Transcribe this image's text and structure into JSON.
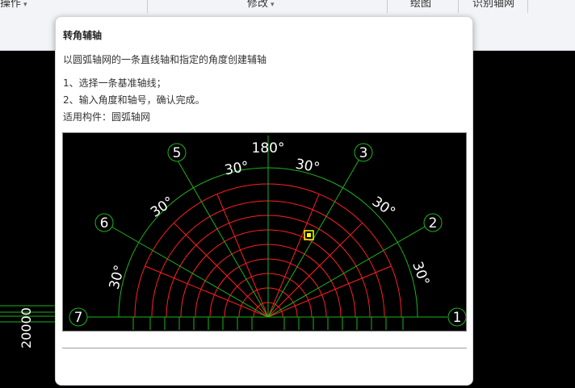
{
  "ribbon": {
    "groups": [
      {
        "label": "操作",
        "has_dropdown": true
      },
      {
        "label": "修改",
        "has_dropdown": true
      },
      {
        "label": "绘图",
        "has_dropdown": false
      },
      {
        "label": "识别轴网",
        "has_dropdown": false
      }
    ],
    "dropdown_glyph": "▾"
  },
  "drawing": {
    "left_axis_label": "20000"
  },
  "tooltip": {
    "title": "转角辅轴",
    "description": "以圆弧轴网的一条直线轴和指定的角度创建辅轴",
    "steps": [
      "1、选择一条基准轴线；",
      "2、输入角度和轴号，确认完成。",
      "适用构件：圆弧轴网"
    ],
    "diagram": {
      "axis_numbers": [
        "1",
        "2",
        "3",
        "5",
        "6",
        "7"
      ],
      "angle_labels": [
        "180°",
        "30°",
        "30°",
        "30°",
        "30°",
        "30°",
        "30°"
      ],
      "colors": {
        "grid_red": "#ff2020",
        "axis_green": "#1db31d",
        "text_white": "#ffffff",
        "marker_yellow": "#ffff00"
      }
    }
  }
}
